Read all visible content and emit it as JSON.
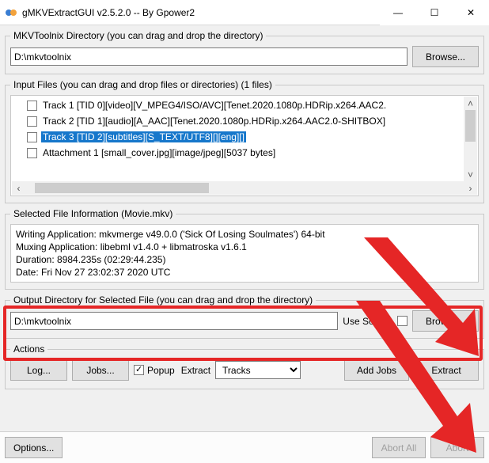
{
  "window": {
    "title": "gMKVExtractGUI v2.5.2.0 -- By Gpower2",
    "min_glyph": "—",
    "max_glyph": "☐",
    "close_glyph": "✕"
  },
  "mkvtoolnix": {
    "legend": "MKVToolnix Directory (you can drag and drop the directory)",
    "path": "D:\\mkvtoolnix",
    "browse": "Browse..."
  },
  "input": {
    "legend": "Input Files (you can drag and drop files or directories) (1 files)",
    "items": [
      "Track 1 [TID 0][video][V_MPEG4/ISO/AVC][Tenet.2020.1080p.HDRip.x264.AAC2.",
      "Track 2 [TID 1][audio][A_AAC][Tenet.2020.1080p.HDRip.x264.AAC2.0-SHITBOX]",
      "Track 3 [TID 2][subtitles][S_TEXT/UTF8][][eng][]",
      "Attachment 1 [small_cover.jpg][image/jpeg][5037 bytes]"
    ],
    "selected_index": 2
  },
  "fileinfo": {
    "legend": "Selected File Information (Movie.mkv)",
    "lines": [
      "Writing Application: mkvmerge v49.0.0 ('Sick Of Losing Soulmates') 64-bit",
      "Muxing Application: libebml v1.4.0 + libmatroska v1.6.1",
      "Duration: 8984.235s (02:29:44.235)",
      "Date: Fri Nov 27 23:02:37 2020 UTC"
    ]
  },
  "output": {
    "legend": "Output Directory for Selected File (you can drag and drop the directory)",
    "path": "D:\\mkvtoolnix",
    "use_source": "Use Source",
    "browse": "Browse..."
  },
  "actions": {
    "legend": "Actions",
    "log": "Log...",
    "jobs": "Jobs...",
    "popup": "Popup",
    "extract_label": "Extract",
    "tracks": "Tracks",
    "add_jobs": "Add Jobs",
    "extract": "Extract"
  },
  "bottom": {
    "options": "Options...",
    "abort_all": "Abort All",
    "abort": "Abort"
  }
}
